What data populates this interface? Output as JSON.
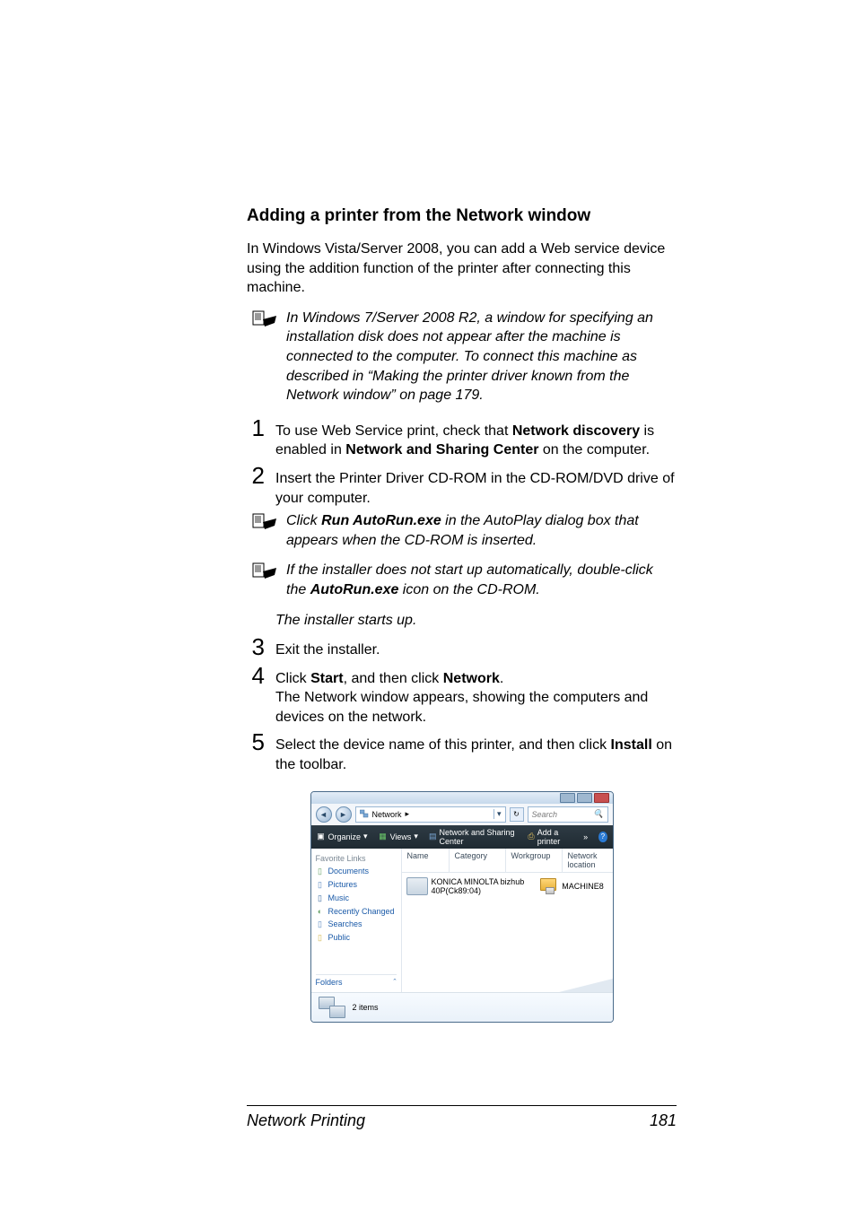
{
  "heading": "Adding a printer from the Network window",
  "intro": "In Windows Vista/Server 2008, you can add a Web service device using the addition function of the printer after connecting this machine.",
  "note_version": "In Windows 7/Server 2008 R2, a window for specifying an installation disk does not appear after the machine is connected to the computer. To connect this machine as described in “Making the printer driver known from the Network window” on page 179.",
  "steps": {
    "s1": {
      "pre": "To use Web Service print, check that ",
      "b1": "Network discovery",
      "mid": " is enabled in ",
      "b2": "Network and Sharing Center",
      "post": " on the computer."
    },
    "s2": "Insert the Printer Driver CD-ROM in the CD-ROM/DVD drive of your computer.",
    "s3": "Exit the installer.",
    "s4": {
      "pre": "Click ",
      "b1": "Start",
      "mid": ", and then click ",
      "b2": "Network",
      "post": ".",
      "sub": "The Network window appears, showing the computers and devices on the network."
    },
    "s5": {
      "pre": "Select the device name of this printer, and then click ",
      "b1": "Install",
      "post": " on the toolbar."
    }
  },
  "sub_notes": {
    "autorun": {
      "pre": "Click ",
      "b1": "Run AutoRun.exe",
      "post": " in the AutoPlay dialog box that appears when the CD-ROM is inserted."
    },
    "doubleclick": {
      "pre": "If the installer does not start up automatically, double-click the ",
      "b1": "AutoRun.exe",
      "post": " icon on the CD-ROM."
    },
    "starts": "The installer starts up."
  },
  "screenshot": {
    "path_label": "Network",
    "search_placeholder": "Search",
    "toolbar": {
      "organize": "Organize",
      "views": "Views",
      "nsc": "Network and Sharing Center",
      "add_printer": "Add a printer",
      "more": "»"
    },
    "cols": {
      "name": "Name",
      "category": "Category",
      "workgroup": "Workgroup",
      "netloc": "Network location"
    },
    "fav_header": "Favorite Links",
    "fav_links": [
      "Documents",
      "Pictures",
      "Music",
      "Recently Changed",
      "Searches",
      "Public"
    ],
    "folders_label": "Folders",
    "items": {
      "device": {
        "line1": "KONICA MINOLTA bizhub",
        "line2": "40P(Ck89:04)"
      },
      "pc": {
        "label": "MACHINE8"
      }
    },
    "status_text": "2 items"
  },
  "footer": {
    "left": "Network Printing",
    "right": "181"
  }
}
